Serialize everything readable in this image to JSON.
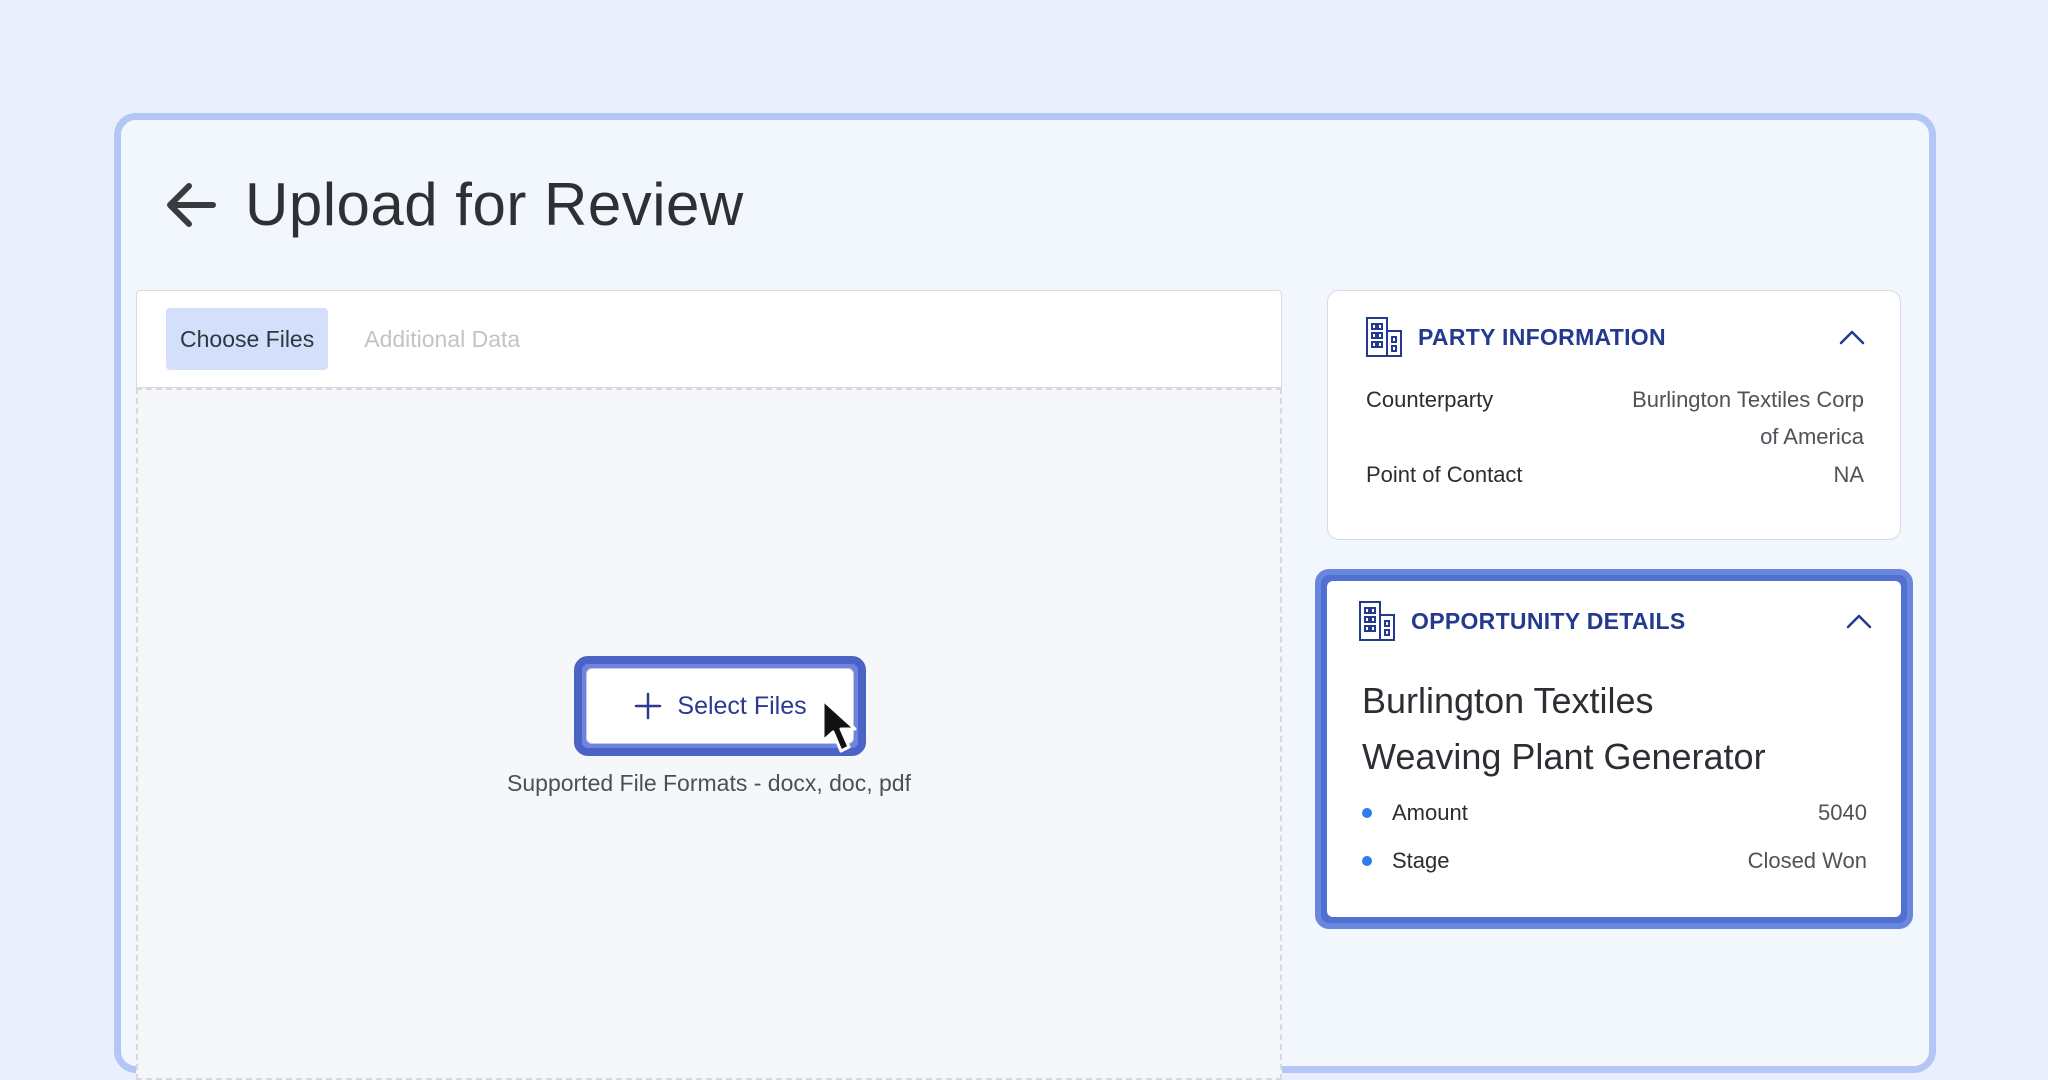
{
  "header": {
    "title": "Upload for Review",
    "back_icon": "arrow-left-icon"
  },
  "tabs": [
    {
      "label": "Choose Files",
      "active": true
    },
    {
      "label": "Additional Data",
      "active": false
    }
  ],
  "dropzone": {
    "button_label": "Select Files",
    "button_icon": "plus-icon",
    "formats_text": "Supported File Formats - docx, doc, pdf"
  },
  "party": {
    "title": "PARTY INFORMATION",
    "icon": "building-icon",
    "rows": [
      {
        "key": "Counterparty",
        "value_line1": "Burlington Textiles Corp",
        "value_line2": "of America"
      },
      {
        "key": "Point of Contact",
        "value": "NA"
      }
    ]
  },
  "opportunity": {
    "title": "OPPORTUNITY DETAILS",
    "icon": "building-icon",
    "name_line1": "Burlington Textiles",
    "name_line2": "Weaving Plant Generator",
    "rows": [
      {
        "key": "Amount",
        "value": "5040"
      },
      {
        "key": "Stage",
        "value": "Closed Won"
      }
    ]
  },
  "colors": {
    "accent": "#243a8e",
    "highlight": "#5270d2",
    "bullet": "#2f7cf0"
  }
}
